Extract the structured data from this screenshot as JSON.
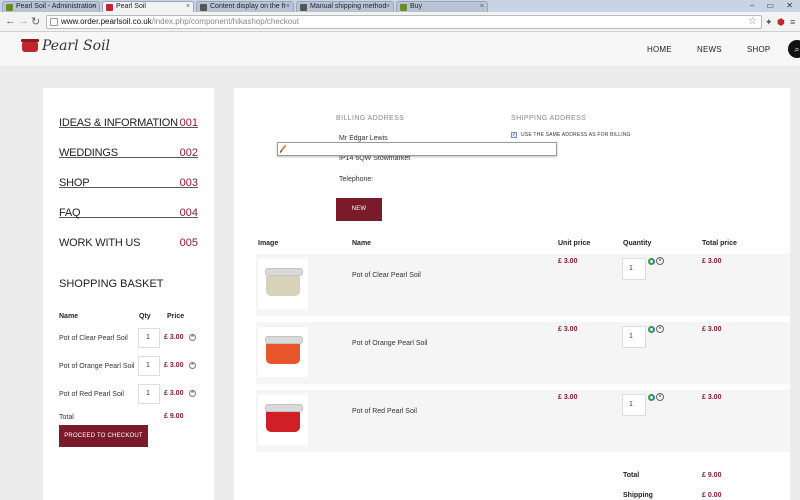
{
  "browser": {
    "tabs": [
      {
        "label": "Pearl Soil - Administration",
        "icon_color": "#6b8e23",
        "active": false
      },
      {
        "label": "Pearl Soil",
        "icon_color": "#c0262d",
        "active": true
      },
      {
        "label": "Content display on the fr",
        "icon_color": "#555555",
        "active": false
      },
      {
        "label": "Manual shipping method",
        "icon_color": "#555555",
        "active": false
      },
      {
        "label": "Buy",
        "icon_color": "#6b8e23",
        "active": false
      }
    ],
    "window_controls": "– ▭ ✕",
    "url_host": "www.order.pearlsoil.co.uk",
    "url_path": "/index.php/component/hikashop/checkout",
    "back_glyph": "←",
    "forward_glyph": "→",
    "reload_glyph": "↻"
  },
  "site": {
    "logo_text": "Pearl Soil",
    "nav": [
      "HOME",
      "NEWS",
      "SHOP"
    ],
    "search_icon": "search-icon"
  },
  "sidebar": {
    "menu": [
      {
        "label": "IDEAS & INFORMATION",
        "num": "001"
      },
      {
        "label": "WEDDINGS",
        "num": "002"
      },
      {
        "label": "SHOP",
        "num": "003"
      },
      {
        "label": "FAQ",
        "num": "004"
      },
      {
        "label": "WORK WITH US",
        "num": "005"
      }
    ],
    "basket": {
      "title": "SHOPPING BASKET",
      "headers": {
        "name": "Name",
        "qty": "Qty",
        "price": "Price"
      },
      "items": [
        {
          "name": "Pot of Clear Pearl Soil",
          "qty": "1",
          "price": "£ 3.00"
        },
        {
          "name": "Pot of Orange Pearl Soil",
          "qty": "1",
          "price": "£ 3.00"
        },
        {
          "name": "Pot of Red Pearl Soil",
          "qty": "1",
          "price": "£ 3.00"
        }
      ],
      "total_label": "Total",
      "total_value": "£ 9.00",
      "checkout_label": "PROCEED TO CHECKOUT"
    }
  },
  "checkout": {
    "billing_heading": "BILLING ADDRESS",
    "shipping_heading": "SHIPPING ADDRESS",
    "billing_lines": [
      "Mr Edgar Lewis",
      "IP14 6QW Stowmarket",
      "Telephone:"
    ],
    "same_address_label": "USE THE SAME ADDRESS AS FOR BILLING",
    "same_address_checked": true,
    "new_button": "NEW",
    "columns": {
      "image": "Image",
      "name": "Name",
      "unit_price": "Unit price",
      "quantity": "Quantity",
      "total_price": "Total price"
    },
    "products": [
      {
        "name": "Pot of Clear Pearl Soil",
        "unit_price": "£ 3.00",
        "qty": "1",
        "total": "£ 3.00",
        "jar_color": "#d8d2b8"
      },
      {
        "name": "Pot of Orange Pearl Soil",
        "unit_price": "£ 3.00",
        "qty": "1",
        "total": "£ 3.00",
        "jar_color": "#e8552a"
      },
      {
        "name": "Pot of Red Pearl Soil",
        "unit_price": "£ 3.00",
        "qty": "1",
        "total": "£ 3.00",
        "jar_color": "#cf2027"
      }
    ],
    "summary": [
      {
        "label": "Total",
        "value": "£ 9.00"
      },
      {
        "label": "Shipping",
        "value": "£ 0.00"
      }
    ]
  },
  "colors": {
    "accent": "#7a1a2b",
    "price": "#8a1c2a"
  }
}
